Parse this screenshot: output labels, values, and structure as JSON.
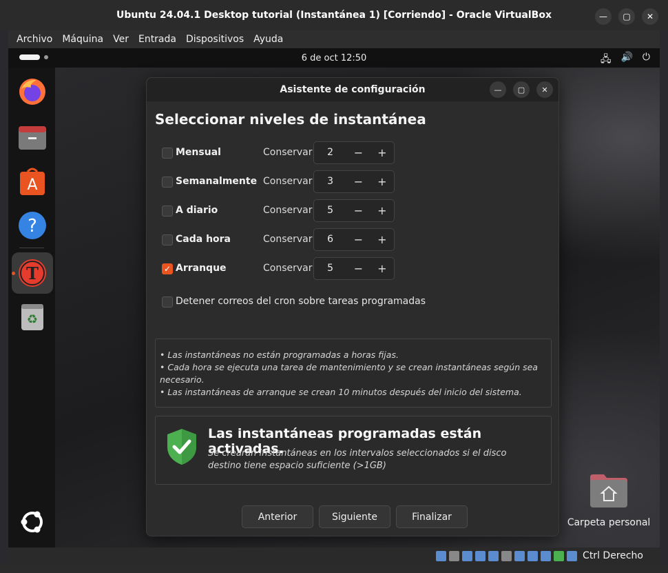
{
  "host": {
    "title": "Ubuntu 24.04.1 Desktop tutorial (Instantánea 1) [Corriendo] - Oracle VirtualBox",
    "menu": [
      "Archivo",
      "Máquina",
      "Ver",
      "Entrada",
      "Dispositivos",
      "Ayuda"
    ],
    "status_label": "Ctrl Derecho"
  },
  "guest": {
    "clock": "6 de oct  12:50",
    "desktop_folder_label": "Carpeta personal"
  },
  "dialog": {
    "title": "Asistente de configuración",
    "heading": "Seleccionar niveles de instantánea",
    "keep_label": "Conservar",
    "levels": [
      {
        "label": "Mensual",
        "checked": false,
        "value": "2"
      },
      {
        "label": "Semanalmente",
        "checked": false,
        "value": "3"
      },
      {
        "label": "A diario",
        "checked": false,
        "value": "5"
      },
      {
        "label": "Cada hora",
        "checked": false,
        "value": "6"
      },
      {
        "label": "Arranque",
        "checked": true,
        "value": "5"
      }
    ],
    "cron_label": "Detener correos del cron sobre tareas programadas",
    "notes": [
      "• Las instantáneas no están programadas a horas fijas.",
      "• Cada hora se ejecuta una tarea de mantenimiento y se crean instantáneas según sea necesario.",
      "• Las instantáneas de arranque se crean 10 minutos después del inicio del sistema."
    ],
    "status_title": "Las instantáneas programadas están activadas.",
    "status_sub": "Se crearán instantáneas en los intervalos seleccionados si el disco destino tiene espacio suficiente (>1GB)",
    "buttons": {
      "previous": "Anterior",
      "next": "Siguiente",
      "finish": "Finalizar"
    }
  },
  "colors": {
    "accent": "#e95420",
    "shield": "#4caf50"
  }
}
